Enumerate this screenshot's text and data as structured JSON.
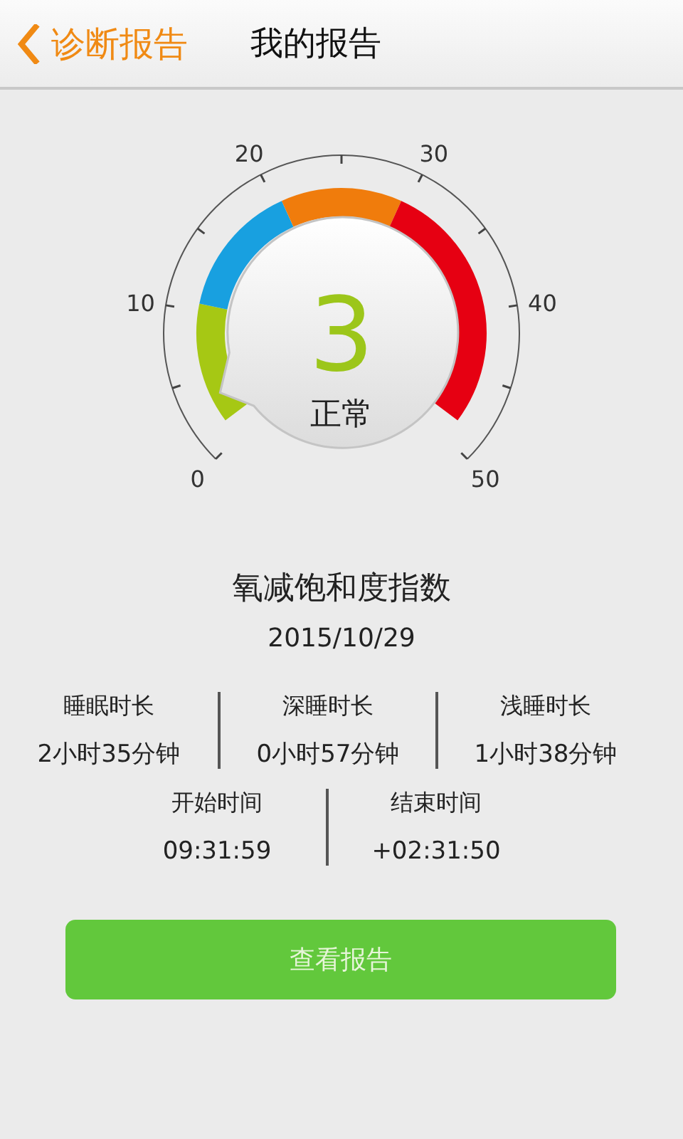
{
  "header": {
    "back_label": "诊断报告",
    "title": "我的报告"
  },
  "gauge": {
    "value": "3",
    "status": "正常",
    "scale_labels": [
      "0",
      "10",
      "20",
      "30",
      "40",
      "50"
    ],
    "bands": [
      {
        "color": "#a6c814"
      },
      {
        "color": "#18a0e0"
      },
      {
        "color": "#f07c0c"
      },
      {
        "color": "#e60012"
      }
    ]
  },
  "metric_title": "氧减饱和度指数",
  "date": "2015/10/29",
  "durations": [
    {
      "label": "睡眠时长",
      "value": "2小时35分钟"
    },
    {
      "label": "深睡时长",
      "value": "0小时57分钟"
    },
    {
      "label": "浅睡时长",
      "value": "1小时38分钟"
    }
  ],
  "times": [
    {
      "label": "开始时间",
      "value": "09:31:59"
    },
    {
      "label": "结束时间",
      "value": "+02:31:50"
    }
  ],
  "button": "查看报告"
}
